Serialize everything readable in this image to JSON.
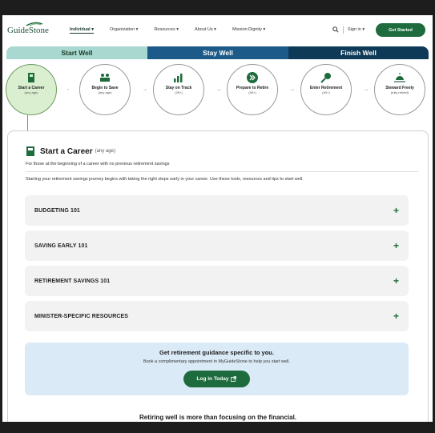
{
  "header": {
    "logo": "GuideStone",
    "nav": [
      "Individual ▾",
      "Organization ▾",
      "Resources ▾",
      "About Us ▾",
      "Mission:Dignity ▾"
    ],
    "signin": "Sign in ▾",
    "cta": "Get Started"
  },
  "tabs": [
    "Start Well",
    "Stay Well",
    "Finish Well"
  ],
  "steps": [
    {
      "label": "Start a Career",
      "sub": "(any age)"
    },
    {
      "label": "Begin to Save",
      "sub": "(any age)"
    },
    {
      "label": "Stay on Track",
      "sub": "(35+)"
    },
    {
      "label": "Prepare to Retire",
      "sub": "(55+)"
    },
    {
      "label": "Enter Retirement",
      "sub": "(60+)"
    },
    {
      "label": "Steward Freely",
      "sub": "(fully retired)"
    }
  ],
  "card": {
    "title": "Start a Career",
    "title_note": "(any age)",
    "subtitle": "For those at the beginning of a career with no previous retirement savings",
    "description": "Starting your retirement savings journey begins with taking the right steps early in your career. Use these tools, resources and tips to start well.",
    "accordions": [
      "BUDGETING 101",
      "SAVING EARLY 101",
      "RETIREMENT SAVINGS 101",
      "MINISTER-SPECIFIC RESOURCES"
    ],
    "plus": "+"
  },
  "cta": {
    "title": "Get retirement guidance specific to you.",
    "text": "Book a complimentary appointment in MyGuideStone to help you start well.",
    "button": "Log in Today"
  },
  "footer_text": "Retiring well is more than focusing on the financial.",
  "colors": {
    "brand_green": "#1e6b3d",
    "tab_start": "#a8d8cf",
    "tab_stay": "#1c5a8a",
    "tab_finish": "#0e3a57",
    "cta_bg": "#dbeaf7"
  }
}
